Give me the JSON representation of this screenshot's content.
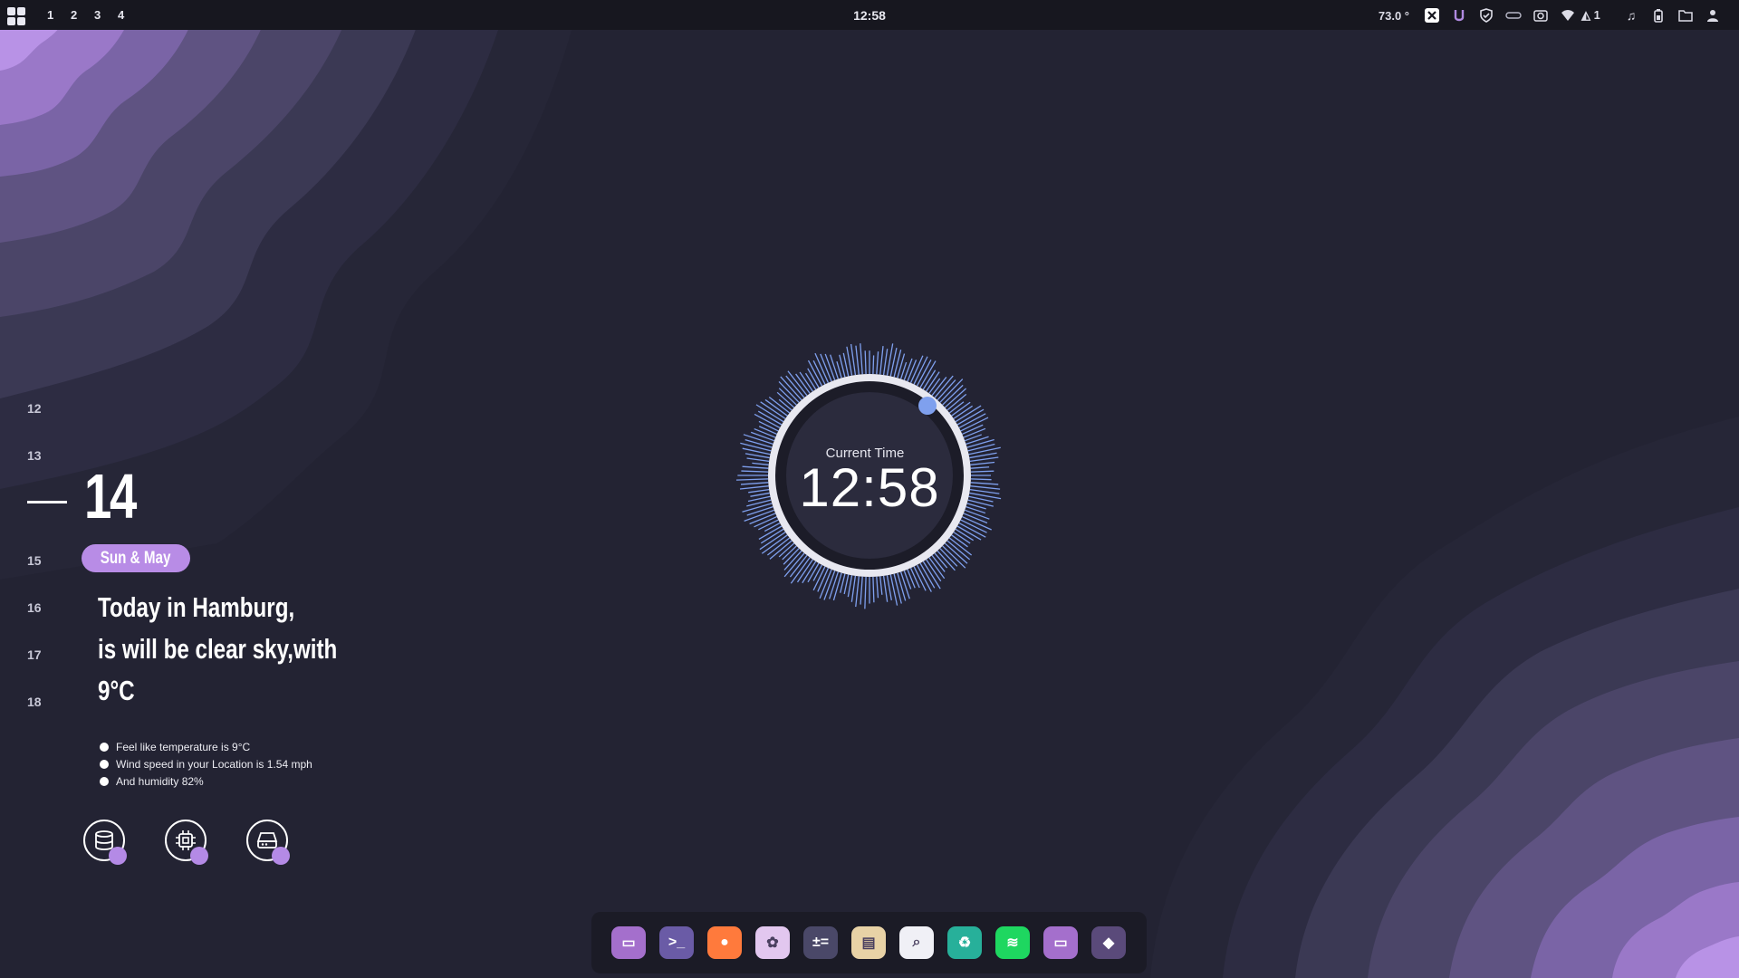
{
  "topbar": {
    "workspaces": [
      "1",
      "2",
      "3",
      "4"
    ],
    "clock": "12:58",
    "tray": {
      "temperature": "73.0 °",
      "notifications_count": "1"
    },
    "tray_icons": [
      "x-icon",
      "u-icon",
      "shield-icon",
      "link-icon",
      "camera-icon",
      "wifi-icon",
      "bell-icon",
      "music-icon",
      "battery-icon",
      "folder-icon",
      "user-icon"
    ]
  },
  "calendar": {
    "hours": [
      "12",
      "13",
      "15",
      "16",
      "17",
      "18"
    ],
    "current_day": "14",
    "day_month_label": "Sun & May"
  },
  "weather": {
    "line1": "Today in Hamburg,",
    "line2": "is will be clear sky,with",
    "line3": "9°C",
    "details": [
      "Feel like temperature is 9°C",
      "Wind speed in your Location is 1.54 mph",
      "And humidity 82%"
    ]
  },
  "system_monitor": [
    {
      "name": "ram-icon"
    },
    {
      "name": "cpu-icon"
    },
    {
      "name": "disk-icon"
    }
  ],
  "clock_widget": {
    "label": "Current Time",
    "time": "12:58",
    "accent_color": "#7fa0ee",
    "ring_color": "#e8e8f0"
  },
  "dock": [
    {
      "name": "file-manager-icon",
      "color": "#a46fcc"
    },
    {
      "name": "terminal-icon",
      "color": "#6a5ba6"
    },
    {
      "name": "firefox-icon",
      "color": "#ff7a3c"
    },
    {
      "name": "settings-flower-icon",
      "color": "#e2c7ef"
    },
    {
      "name": "calculator-icon",
      "color": "#4a4868"
    },
    {
      "name": "image-viewer-icon",
      "color": "#e8d2a6"
    },
    {
      "name": "search-icon",
      "color": "#f0f0f6"
    },
    {
      "name": "recycle-bin-icon",
      "color": "#27b09a"
    },
    {
      "name": "spotify-icon",
      "color": "#1ed760"
    },
    {
      "name": "screenshot-icon",
      "color": "#a46fcc"
    },
    {
      "name": "app-store-icon",
      "color": "#5a4a7a"
    }
  ]
}
